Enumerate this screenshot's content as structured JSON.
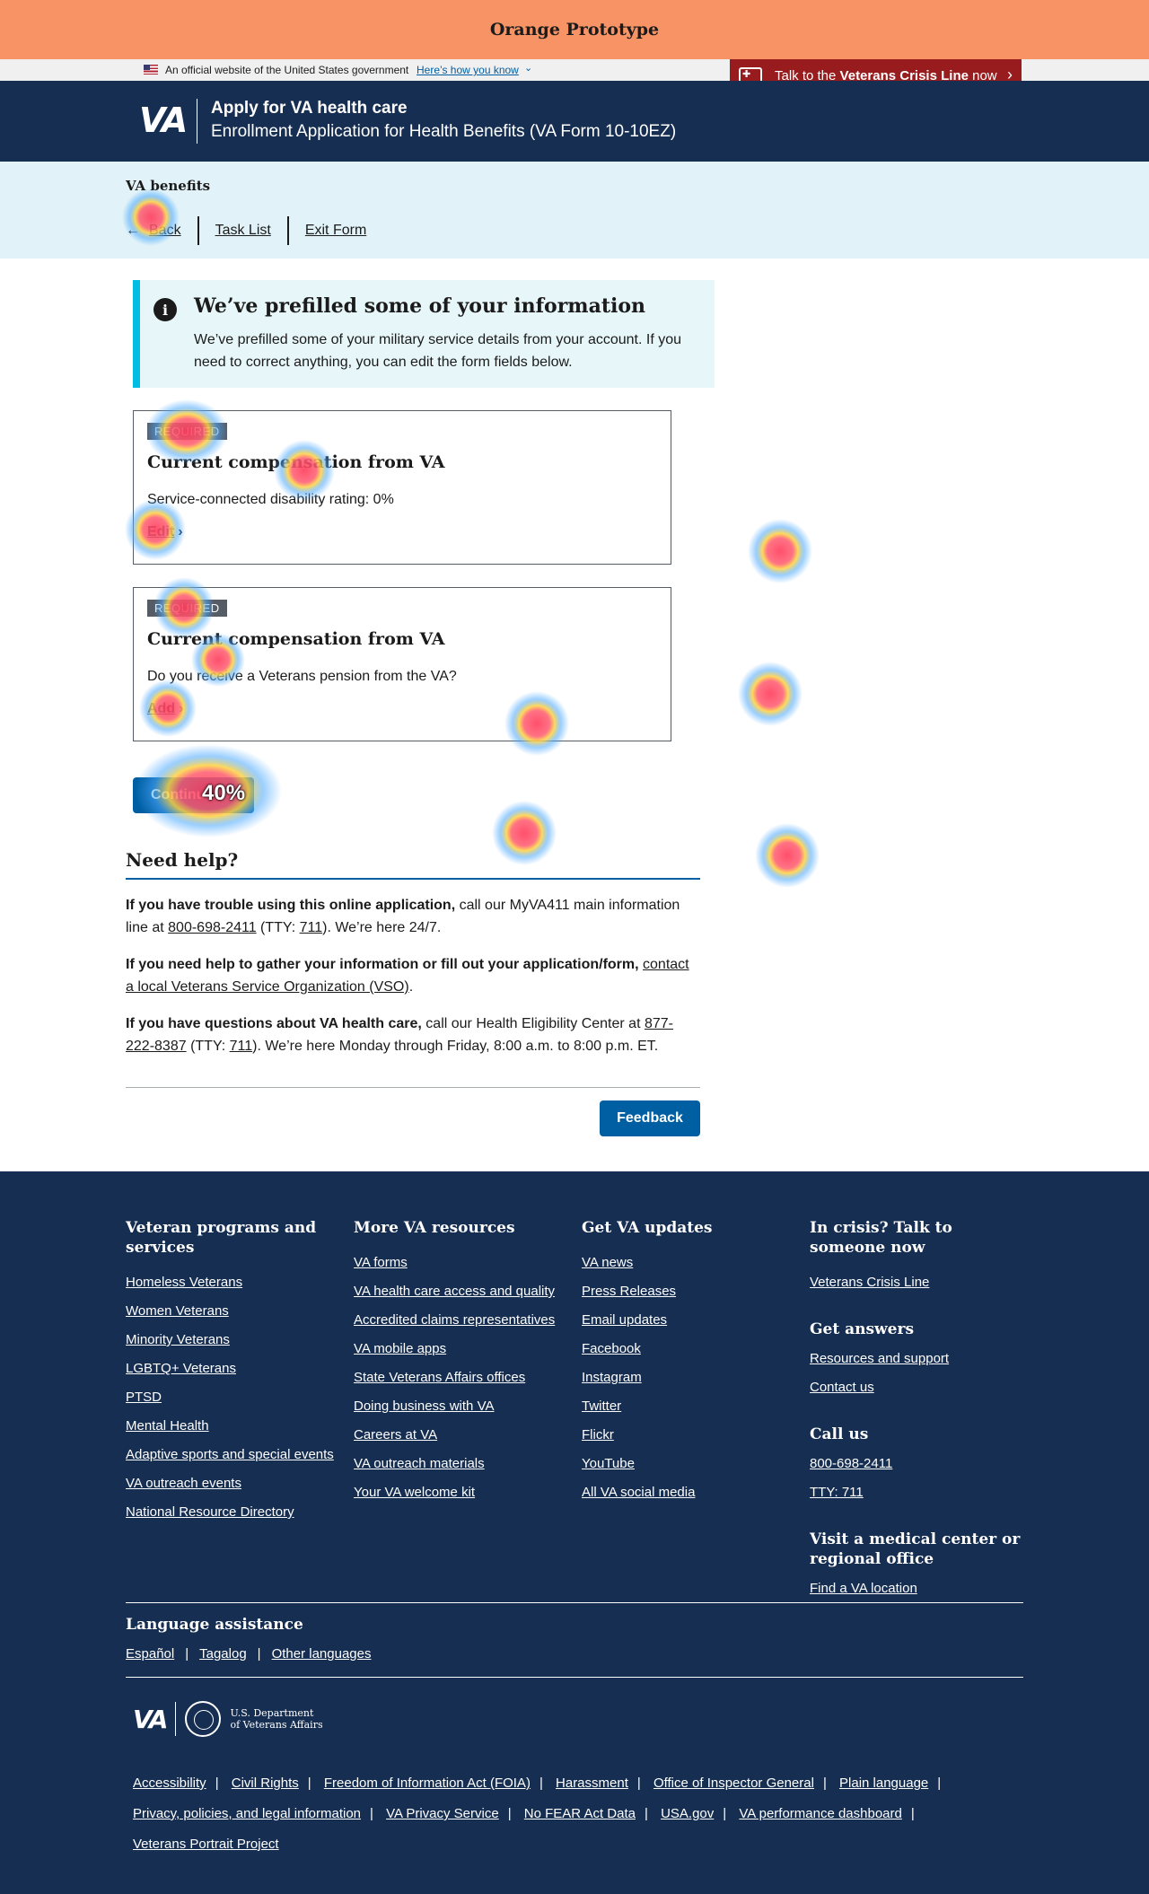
{
  "prototype_banner": "Orange Prototype",
  "gov_banner": {
    "text": "An official website of the United States government",
    "link": "Here’s how you know"
  },
  "crisis_line": {
    "pre": "Talk to the ",
    "bold": "Veterans Crisis Line",
    "post": " now"
  },
  "header": {
    "logo": "VA",
    "title": "Apply for VA health care",
    "subtitle": "Enrollment Application for Health Benefits (VA Form 10-10EZ)"
  },
  "breadcrumb": {
    "label": "VA benefits",
    "back": "Back",
    "task_list": "Task List",
    "exit": "Exit Form"
  },
  "alert": {
    "heading": "We’ve prefilled some of your information",
    "body": "We’ve prefilled some of your military service details from your account. If you need to correct anything, you can edit the form fields below."
  },
  "cards": [
    {
      "badge": "REQUIRED",
      "title": "Current compensation from VA",
      "desc": "Service-connected disability rating: 0%",
      "link": "Edit"
    },
    {
      "badge": "REQUIRED",
      "title": "Current compensation from VA",
      "desc": "Do you receive a Veterans pension from the VA?",
      "link": "Add"
    }
  ],
  "continue_label": "Continue",
  "heat_label": "40%",
  "need_help": {
    "heading": "Need help?",
    "p1_bold": "If you have trouble using this online application,",
    "p1_a": " call our MyVA411 main information line at ",
    "p1_phone": "800-698-2411",
    "p1_b": " (TTY: ",
    "p1_tty": "711",
    "p1_c": "). We’re here 24/7.",
    "p2_bold": "If you need help to gather your information or fill out your application/form,",
    "p2_link": "contact a local Veterans Service Organization (VSO)",
    "p2_end": ".",
    "p3_bold": "If you have questions about VA health care,",
    "p3_a": " call our Health Eligibility Center at ",
    "p3_phone": "877-222-8387",
    "p3_b": " (TTY: ",
    "p3_tty": "711",
    "p3_c": "). We’re here Monday through Friday, 8:00 a.m. to 8:00 p.m. ET.",
    "feedback": "Feedback"
  },
  "footer": {
    "col1": {
      "heading": "Veteran programs and services",
      "links": [
        "Homeless Veterans",
        "Women Veterans",
        "Minority Veterans",
        "LGBTQ+ Veterans",
        "PTSD",
        "Mental Health",
        "Adaptive sports and special events",
        "VA outreach events",
        "National Resource Directory"
      ]
    },
    "col2": {
      "heading": "More VA resources",
      "links": [
        "VA forms",
        "VA health care access and quality",
        "Accredited claims representatives",
        "VA mobile apps",
        "State Veterans Affairs offices",
        "Doing business with VA",
        "Careers at VA",
        "VA outreach materials",
        "Your VA welcome kit"
      ]
    },
    "col3": {
      "heading": "Get VA updates",
      "links": [
        "VA news",
        "Press Releases",
        "Email updates",
        "Facebook",
        "Instagram",
        "Twitter",
        "Flickr",
        "YouTube",
        "All VA social media"
      ]
    },
    "col4": {
      "heading": "In crisis? Talk to someone now",
      "crisis_link": "Veterans Crisis Line",
      "answers_heading": "Get answers",
      "answers_links": [
        "Resources and support",
        "Contact us"
      ],
      "call_heading": "Call us",
      "call_links": [
        "800-698-2411",
        "TTY: 711"
      ],
      "visit_heading": "Visit a medical center or regional office",
      "visit_link": "Find a VA location"
    },
    "language": {
      "heading": "Language assistance",
      "links": [
        "Español",
        "Tagalog",
        "Other languages"
      ]
    },
    "logo": "VA",
    "dept": [
      "U.S. Department",
      "of Veterans Affairs"
    ],
    "bottom_links": [
      "Accessibility",
      "Civil Rights",
      "Freedom of Information Act (FOIA)",
      "Harassment",
      "Office of Inspector General",
      "Plain language",
      "Privacy, policies, and legal information",
      "VA Privacy Service",
      "No FEAR Act Data",
      "USA.gov",
      "VA performance dashboard",
      "Veterans Portrait Project"
    ]
  },
  "colors": {
    "prototype": "#f79365",
    "navy": "#162e51",
    "crisis": "#981b1e",
    "primary": "#005ea2",
    "info_bg": "#e7f6f8",
    "info_border": "#00bde3",
    "breadcrumb_bg": "#e1f3f8"
  }
}
